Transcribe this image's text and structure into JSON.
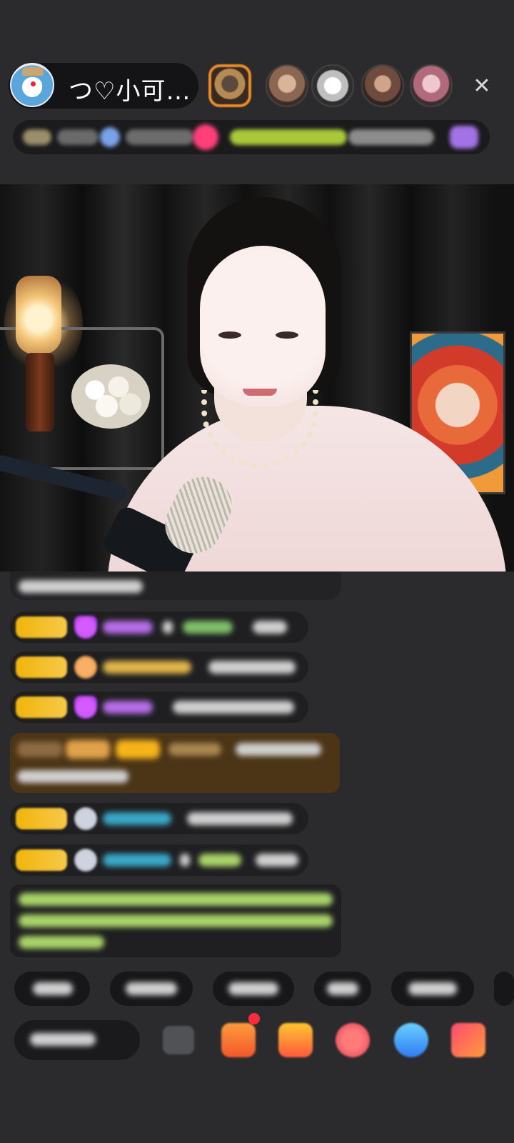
{
  "header": {
    "host_name": "つ♡小可…",
    "close_glyph": "✕"
  },
  "colors": {
    "background": "#2b2b2d",
    "level_badge": "#f1b40c",
    "gift_row": "#4c3517",
    "notice_text": "#a9d36a"
  },
  "icons": {
    "host_avatar": "doraemon-avatar-icon",
    "close": "close-icon",
    "comment": "comment-input",
    "gift": "gift-icon"
  }
}
